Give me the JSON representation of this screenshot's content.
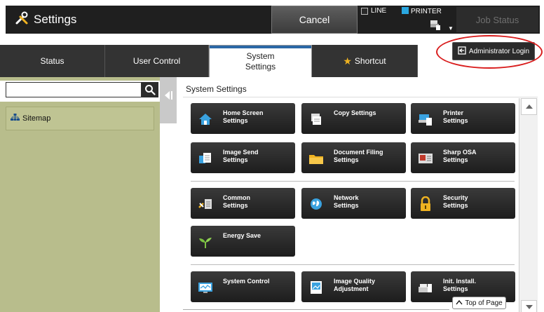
{
  "topbar": {
    "title": "Settings",
    "cancel_label": "Cancel",
    "mode_line_label": "LINE",
    "mode_printer_label": "PRINTER",
    "job_status_label": "Job Status"
  },
  "tabs": [
    {
      "label": "Status"
    },
    {
      "label": "User Control"
    },
    {
      "label": "System\nSettings"
    },
    {
      "label": "Shortcut"
    }
  ],
  "admin": {
    "label": "Administrator Login"
  },
  "sidebar": {
    "search_value": "",
    "sitemap_label": "Sitemap"
  },
  "content": {
    "title": "System Settings",
    "tiles": [
      {
        "label": "Home Screen\nSettings",
        "icon": "home-icon"
      },
      {
        "label": "Copy Settings",
        "icon": "copy-icon"
      },
      {
        "label": "Printer\nSettings",
        "icon": "printer-icon"
      },
      {
        "label": "Image Send\nSettings",
        "icon": "image-send-icon"
      },
      {
        "label": "Document Filing\nSettings",
        "icon": "folder-icon"
      },
      {
        "label": "Sharp OSA\nSettings",
        "icon": "osa-icon"
      },
      {
        "label": "Common\nSettings",
        "icon": "common-settings-icon"
      },
      {
        "label": "Network\nSettings",
        "icon": "globe-icon"
      },
      {
        "label": "Security\nSettings",
        "icon": "lock-icon"
      },
      {
        "label": "Energy Save",
        "icon": "sprout-icon"
      },
      {
        "label": "System Control",
        "icon": "monitor-icon"
      },
      {
        "label": "Image Quality\nAdjustment",
        "icon": "image-quality-icon"
      },
      {
        "label": "Init. Install.\nSettings",
        "icon": "install-icon"
      }
    ],
    "top_of_page_label": "Top of Page"
  },
  "colors": {
    "accent": "#2b67a5",
    "sidebar_bg": "#b8bd8c",
    "annotation_oval": "#d91d1d",
    "star": "#f0b321"
  }
}
